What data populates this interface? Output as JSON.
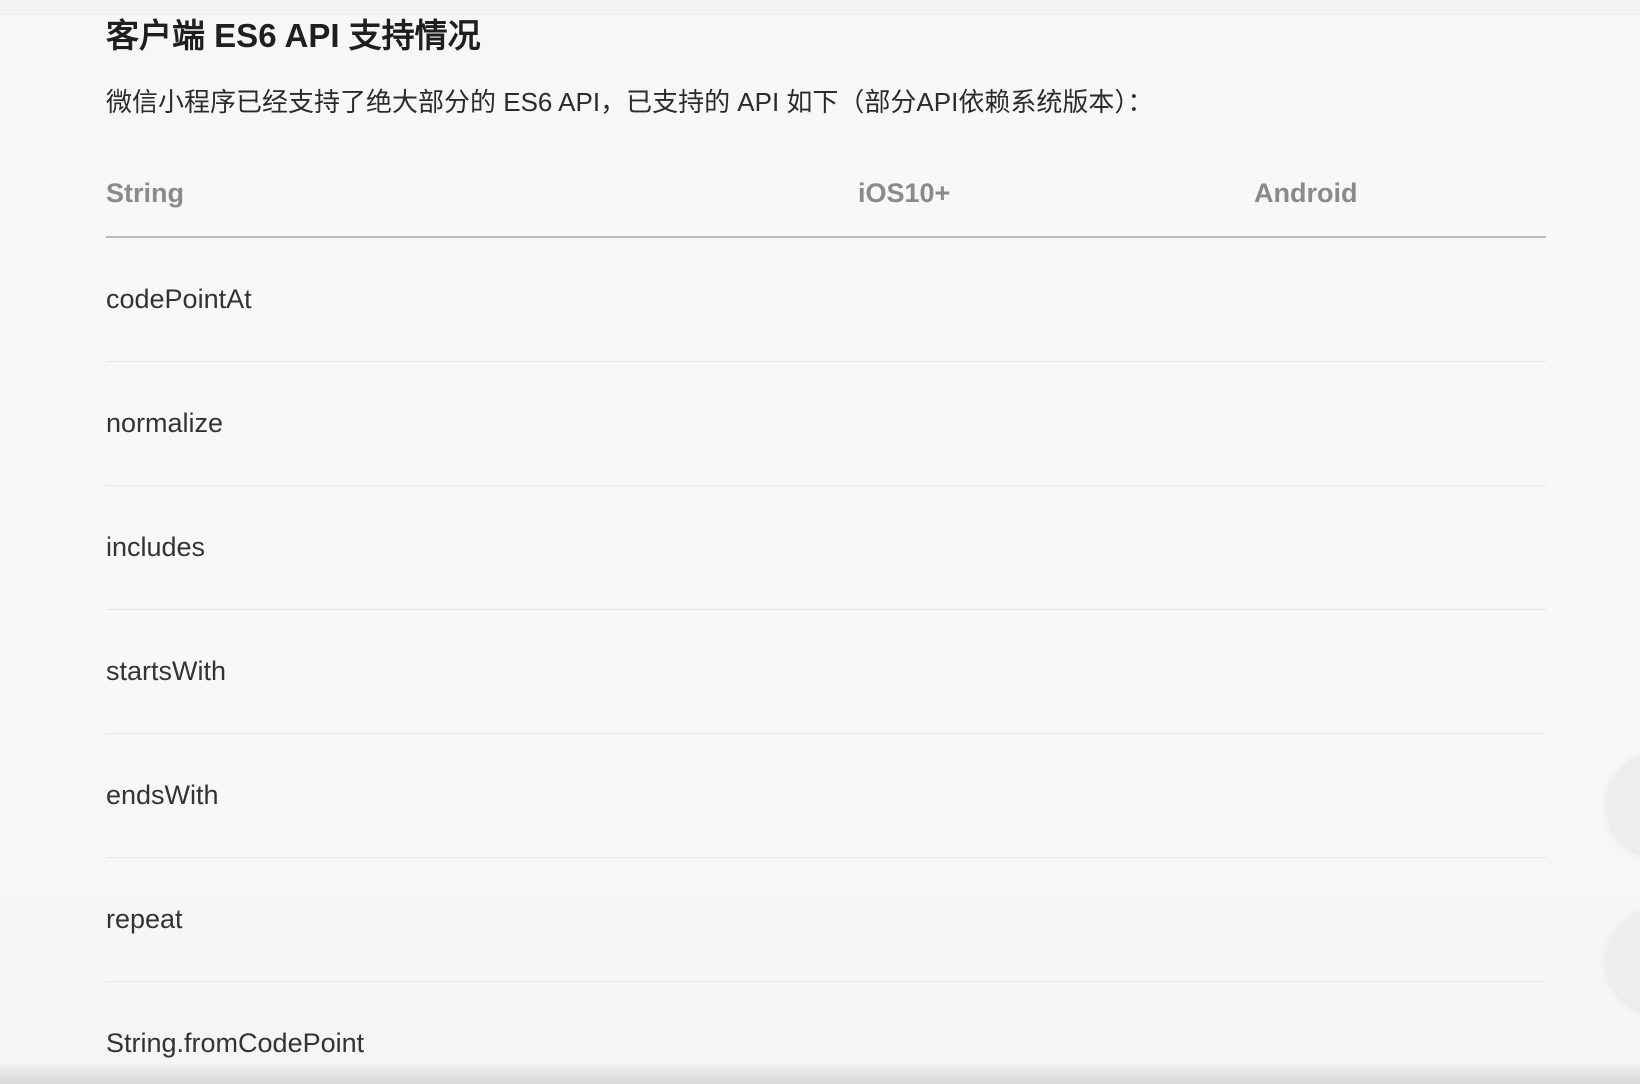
{
  "section": {
    "heading": "客户端 ES6 API 支持情况",
    "intro": "微信小程序已经支持了绝大部分的 ES6 API，已支持的 API 如下（部分API依赖系统版本）："
  },
  "table": {
    "headers": {
      "name": "String",
      "ios": "iOS10+",
      "android": "Android"
    },
    "rows": [
      {
        "name": "codePointAt",
        "ios": "",
        "android": ""
      },
      {
        "name": "normalize",
        "ios": "",
        "android": ""
      },
      {
        "name": "includes",
        "ios": "",
        "android": ""
      },
      {
        "name": "startsWith",
        "ios": "",
        "android": ""
      },
      {
        "name": "endsWith",
        "ios": "",
        "android": ""
      },
      {
        "name": "repeat",
        "ios": "",
        "android": ""
      },
      {
        "name": "String.fromCodePoint",
        "ios": "",
        "android": ""
      }
    ]
  },
  "floating_buttons": {
    "top_icon": "",
    "bottom_icon": ""
  }
}
